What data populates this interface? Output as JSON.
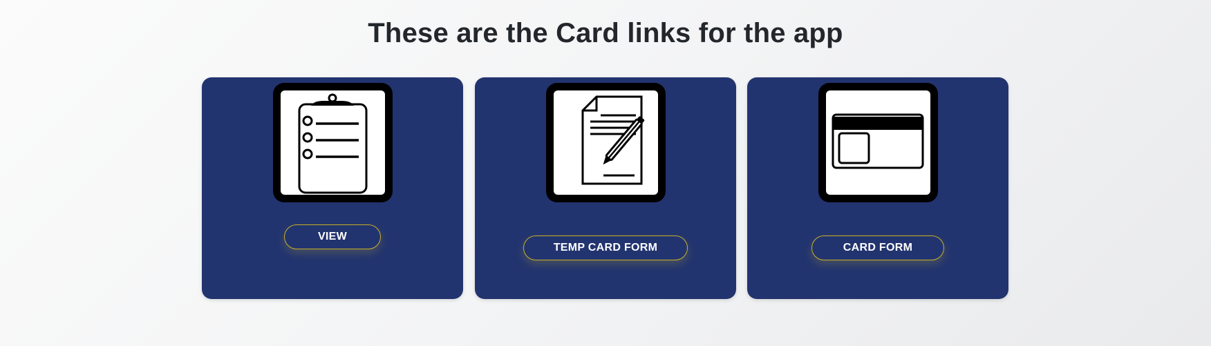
{
  "page": {
    "title": "These are the Card links for the app"
  },
  "cards": [
    {
      "icon": "clipboard-checklist-icon",
      "button_label": "VIEW"
    },
    {
      "icon": "document-pen-icon",
      "button_label": "TEMP CARD FORM"
    },
    {
      "icon": "credit-card-icon",
      "button_label": "CARD FORM"
    }
  ],
  "colors": {
    "card_background": "#22346f",
    "button_border": "#c9b227",
    "title_text": "#23272b"
  }
}
